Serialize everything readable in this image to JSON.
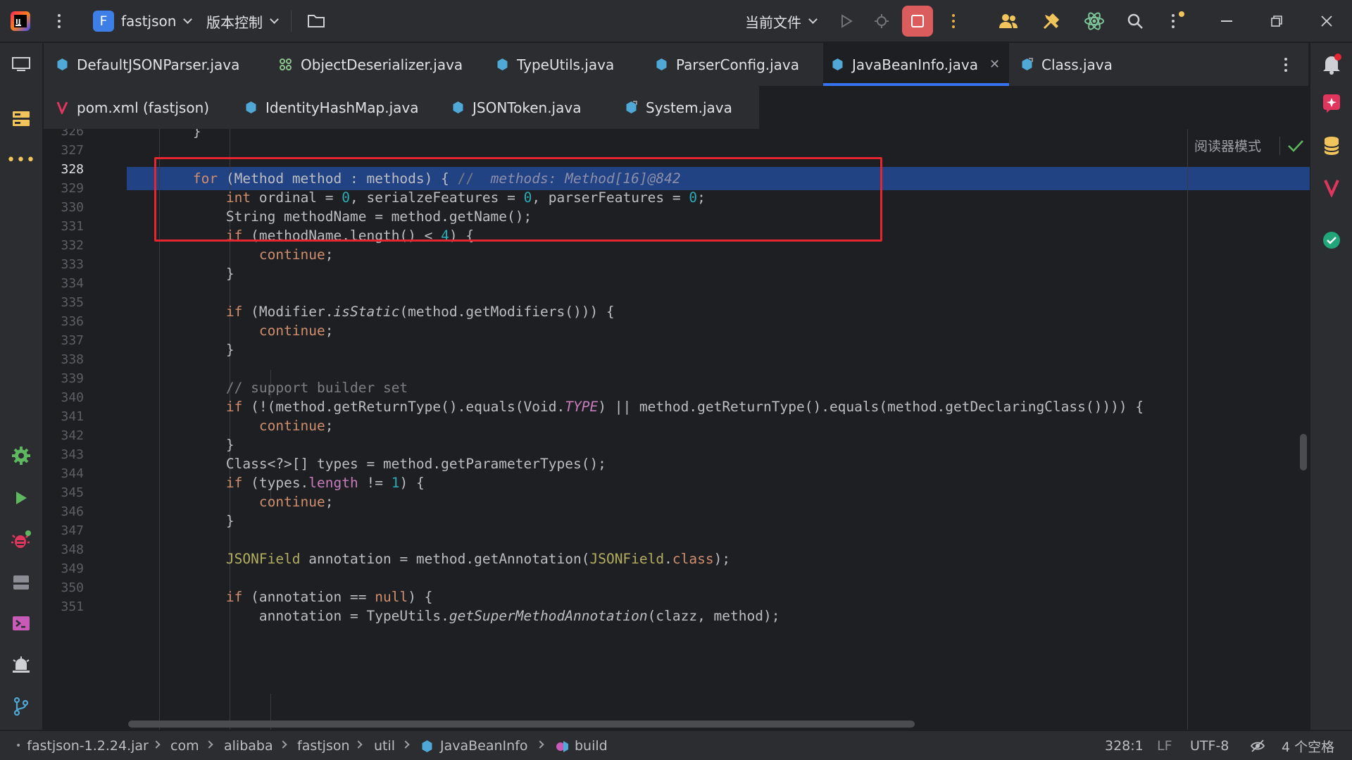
{
  "titlebar": {
    "project_letter": "F",
    "project_name": "fastjson",
    "vcs_label": "版本控制",
    "run_config": "当前文件"
  },
  "tabs_row1": [
    {
      "label": "DefaultJSONParser.java",
      "active": false
    },
    {
      "label": "ObjectDeserializer.java",
      "active": false
    },
    {
      "label": "TypeUtils.java",
      "active": false
    },
    {
      "label": "ParserConfig.java",
      "active": false
    },
    {
      "label": "JavaBeanInfo.java",
      "active": true
    },
    {
      "label": "Class.java",
      "active": false
    }
  ],
  "tabs_row2": [
    {
      "label": "pom.xml (fastjson)"
    },
    {
      "label": "IdentityHashMap.java"
    },
    {
      "label": "JSONToken.java"
    },
    {
      "label": "System.java"
    }
  ],
  "editor": {
    "reader_mode": "阅读器模式",
    "current_line": 328,
    "line_numbers": [
      "326",
      "327",
      "328",
      "329",
      "330",
      "331",
      "332",
      "333",
      "334",
      "335",
      "336",
      "337",
      "338",
      "339",
      "340",
      "341",
      "342",
      "343",
      "344",
      "345",
      "346",
      "347",
      "348",
      "349",
      "350",
      "351"
    ],
    "debug_hint": "methods: Method[16]@842"
  },
  "statusbar": {
    "breadcrumbs": [
      "fastjson-1.2.24.jar",
      "com",
      "alibaba",
      "fastjson",
      "util",
      "JavaBeanInfo",
      "build"
    ],
    "position": "328:1",
    "line_sep": "LF",
    "encoding": "UTF-8",
    "indent": "4 个空格"
  },
  "colors": {
    "accent": "#3574f0",
    "highlight_row": "#214283",
    "annotation_box": "#e3262f",
    "stop_button": "#db5c5c"
  }
}
